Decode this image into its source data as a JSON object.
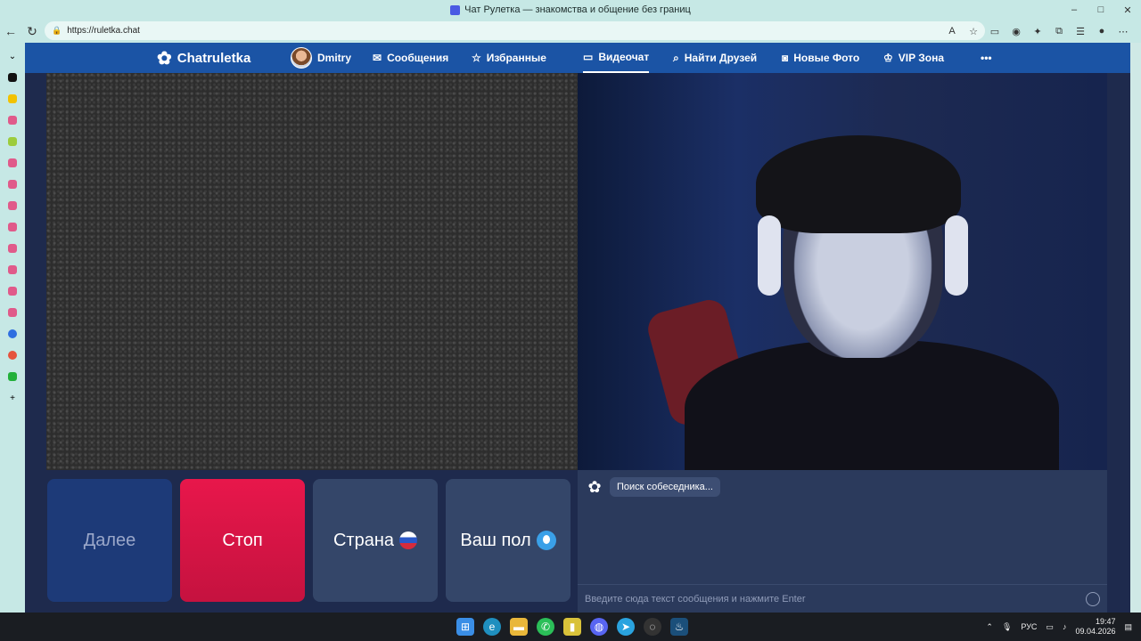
{
  "window": {
    "title": "Чат Рулетка — знакомства и общение без границ",
    "minimize": "–",
    "maximize": "□",
    "close": "✕"
  },
  "browser": {
    "url": "https://ruletka.chat"
  },
  "site": {
    "brand": "Chatruletka",
    "nav": [
      {
        "label": "Dmitry",
        "icon": "avatar"
      },
      {
        "label": "Сообщения",
        "icon": "mail-icon"
      },
      {
        "label": "Избранные",
        "icon": "star-icon"
      },
      {
        "label": "Видеочат",
        "icon": "video-icon",
        "active": true
      },
      {
        "label": "Найти Друзей",
        "icon": "search-icon"
      },
      {
        "label": "Новые Фото",
        "icon": "camera-icon"
      },
      {
        "label": "VIP Зона",
        "icon": "crown-icon"
      },
      {
        "label": "•••",
        "icon": "more-icon"
      }
    ]
  },
  "controls": {
    "next": "Далее",
    "stop": "Стоп",
    "country": "Страна",
    "gender": "Ваш пол"
  },
  "chat": {
    "status": "Поиск собеседника...",
    "input_placeholder": "Введите сюда текст сообщения и нажмите Enter"
  },
  "taskbar": {
    "lang": "РУС",
    "time": "19:47",
    "date": "09.04.2026"
  },
  "colors": {
    "nav_bg": "#1b54a5",
    "stop": "#e8174b",
    "next": "#1d3a78",
    "panel": "#344669"
  }
}
